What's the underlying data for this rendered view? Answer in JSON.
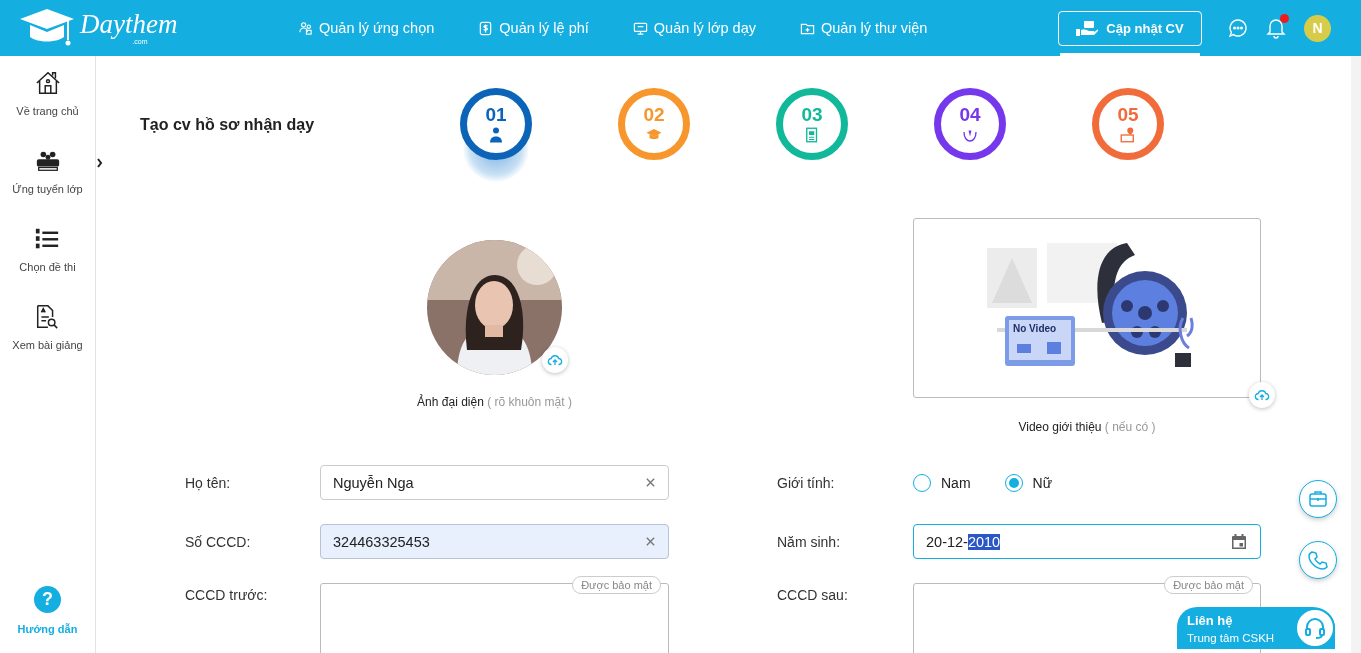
{
  "header": {
    "logo": {
      "name": "Daythem",
      "suffix": ".com"
    },
    "nav": [
      {
        "label": "Quản lý ứng chọn"
      },
      {
        "label": "Quản lý lệ phí"
      },
      {
        "label": "Quản lý lớp dạy"
      },
      {
        "label": "Quản lý thư viện"
      }
    ],
    "cv_button": {
      "label": "Cập nhật CV",
      "selected": true
    },
    "notifications_unread": true,
    "avatar_initial": "N"
  },
  "sidebar": {
    "items": [
      {
        "label": "Về trang chủ"
      },
      {
        "label": "Ứng tuyển lớp",
        "expanded": false
      },
      {
        "label": "Chọn đề thi"
      },
      {
        "label": "Xem bài giảng"
      }
    ],
    "help": {
      "icon_text": "?",
      "label": "Hướng dẫn"
    }
  },
  "title": "Tạo cv hồ sơ nhận dạy",
  "steps": [
    {
      "number": "01",
      "color": "#0b64b8",
      "selected": true
    },
    {
      "number": "02",
      "color": "#f7962c",
      "selected": false
    },
    {
      "number": "03",
      "color": "#12b89a",
      "selected": false
    },
    {
      "number": "04",
      "color": "#7638ec",
      "selected": false
    },
    {
      "number": "05",
      "color": "#f26b3a",
      "selected": false
    }
  ],
  "photo": {
    "kind": "picture",
    "label": "Ảnh đại diện",
    "hint": "( rõ khuôn mặt )"
  },
  "video": {
    "screen_text": "No Video",
    "label": "Video giới thiệu",
    "hint": "( nếu có )"
  },
  "form": [
    {
      "label": "Họ tên:",
      "kind": "text",
      "value": "Nguyễn Nga",
      "autofilled": false
    },
    {
      "label": "Giới tính:",
      "kind": "radio",
      "options": [
        {
          "label": "Nam",
          "selected": false
        },
        {
          "label": "Nữ",
          "selected": true
        }
      ]
    },
    {
      "label": "Số CCCD:",
      "kind": "text",
      "value": "324463325453",
      "autofilled": true
    },
    {
      "label": "Năm sinh:",
      "kind": "date",
      "value": "20-12-",
      "selected_value": "2010",
      "focused": true
    },
    {
      "label": "CCCD trước:",
      "kind": "upload",
      "badge": "Được bảo mật"
    },
    {
      "label": "CCCD sau:",
      "kind": "upload",
      "badge": "Được bảo mật"
    }
  ],
  "contact": {
    "title": "Liên hệ",
    "subtitle": "Trung tâm CSKH"
  }
}
